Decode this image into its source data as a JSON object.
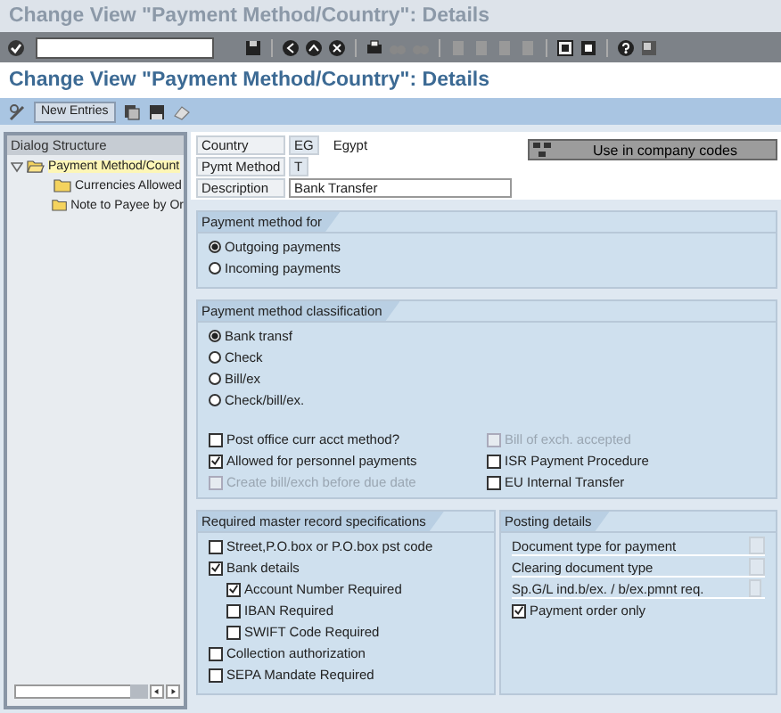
{
  "window": {
    "title": "Change View \"Payment Method/Country\": Details"
  },
  "screen_title": "Change View \"Payment Method/Country\": Details",
  "app_toolbar": {
    "buttons": [
      {
        "label": "New Entries"
      }
    ]
  },
  "dialog_structure": {
    "title": "Dialog Structure",
    "items": [
      {
        "label": "Payment Method/Count",
        "selected": true,
        "expanded": true,
        "children": [
          {
            "label": "Currencies Allowed",
            "selected": false
          },
          {
            "label": "Note to Payee by Or",
            "selected": false
          }
        ]
      }
    ]
  },
  "header_fields": [
    {
      "label": "Country",
      "value": "EG",
      "description": "Egypt"
    },
    {
      "label": "Pymt Method",
      "value": "T"
    },
    {
      "label": "Description",
      "value": "Bank Transfer"
    }
  ],
  "company_codes_button": {
    "label": "Use in company codes"
  },
  "payment_method_for": {
    "title": "Payment method for",
    "options": [
      {
        "label": "Outgoing payments",
        "selected": true
      },
      {
        "label": "Incoming payments",
        "selected": false
      }
    ]
  },
  "classification": {
    "title": "Payment method classification",
    "options": [
      {
        "label": "Bank transf",
        "selected": true
      },
      {
        "label": "Check",
        "selected": false
      },
      {
        "label": "Bill/ex",
        "selected": false
      },
      {
        "label": "Check/bill/ex.",
        "selected": false
      }
    ],
    "checks_left": [
      {
        "label": "Post office curr acct method?",
        "checked": false,
        "disabled": false
      },
      {
        "label": "Allowed for personnel payments",
        "checked": true,
        "disabled": false
      },
      {
        "label": "Create bill/exch before due date",
        "checked": false,
        "disabled": true
      }
    ],
    "checks_right": [
      {
        "label": "Bill of exch. accepted",
        "checked": false,
        "disabled": true
      },
      {
        "label": "ISR Payment Procedure",
        "checked": false,
        "disabled": false
      },
      {
        "label": "EU Internal Transfer",
        "checked": false,
        "disabled": false
      }
    ]
  },
  "master_record": {
    "title": "Required master record specifications",
    "items": [
      {
        "label": "Street,P.O.box or P.O.box pst code",
        "checked": false
      },
      {
        "label": "Bank details",
        "checked": true,
        "children": [
          {
            "label": "Account Number Required",
            "checked": true
          },
          {
            "label": "IBAN Required",
            "checked": false
          },
          {
            "label": "SWIFT Code Required",
            "checked": false
          }
        ]
      },
      {
        "label": "Collection authorization",
        "checked": false
      },
      {
        "label": "SEPA Mandate Required",
        "checked": false
      }
    ]
  },
  "posting_details": {
    "title": "Posting details",
    "fields": [
      {
        "label": "Document type for payment"
      },
      {
        "label": "Clearing document type"
      },
      {
        "label": "Sp.G/L ind.b/ex. / b/ex.pmnt req."
      }
    ],
    "checks": [
      {
        "label": "Payment order only",
        "checked": true
      }
    ]
  }
}
